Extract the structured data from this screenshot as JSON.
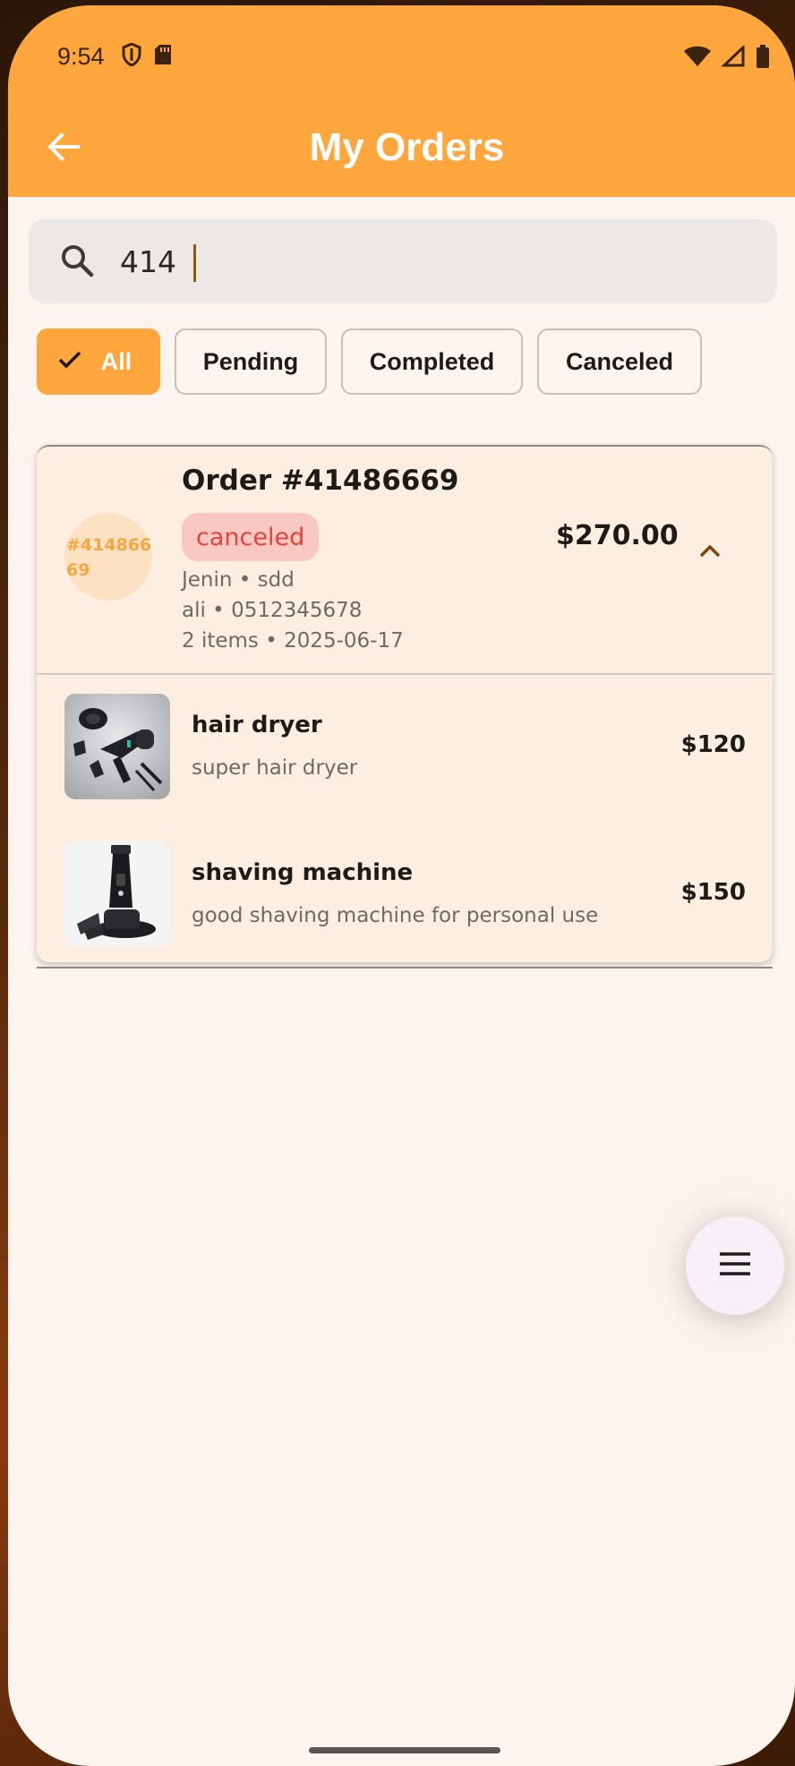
{
  "status_bar": {
    "time": "9:54"
  },
  "app_bar": {
    "title": "My Orders",
    "color": "#ffa63d"
  },
  "search": {
    "value": "414",
    "placeholder": ""
  },
  "filters": [
    {
      "label": "All",
      "selected": true
    },
    {
      "label": "Pending",
      "selected": false
    },
    {
      "label": "Completed",
      "selected": false
    },
    {
      "label": "Canceled",
      "selected": false
    }
  ],
  "order": {
    "avatar_text": "#41486669",
    "title": "Order #41486669",
    "status": "canceled",
    "total": "$270.00",
    "meta_line1": "Jenin • sdd",
    "meta_line2": "ali • 0512345678",
    "meta_line3": "2 items • 2025-06-17",
    "items": [
      {
        "name": "hair dryer",
        "description": "super hair dryer",
        "price": "$120",
        "thumb_icon": "hair-dryer-product-image"
      },
      {
        "name": "shaving machine",
        "description": "good shaving machine for personal use",
        "price": "$150",
        "thumb_icon": "shaving-machine-product-image"
      }
    ]
  },
  "fab": {
    "icon": "menu-icon"
  }
}
